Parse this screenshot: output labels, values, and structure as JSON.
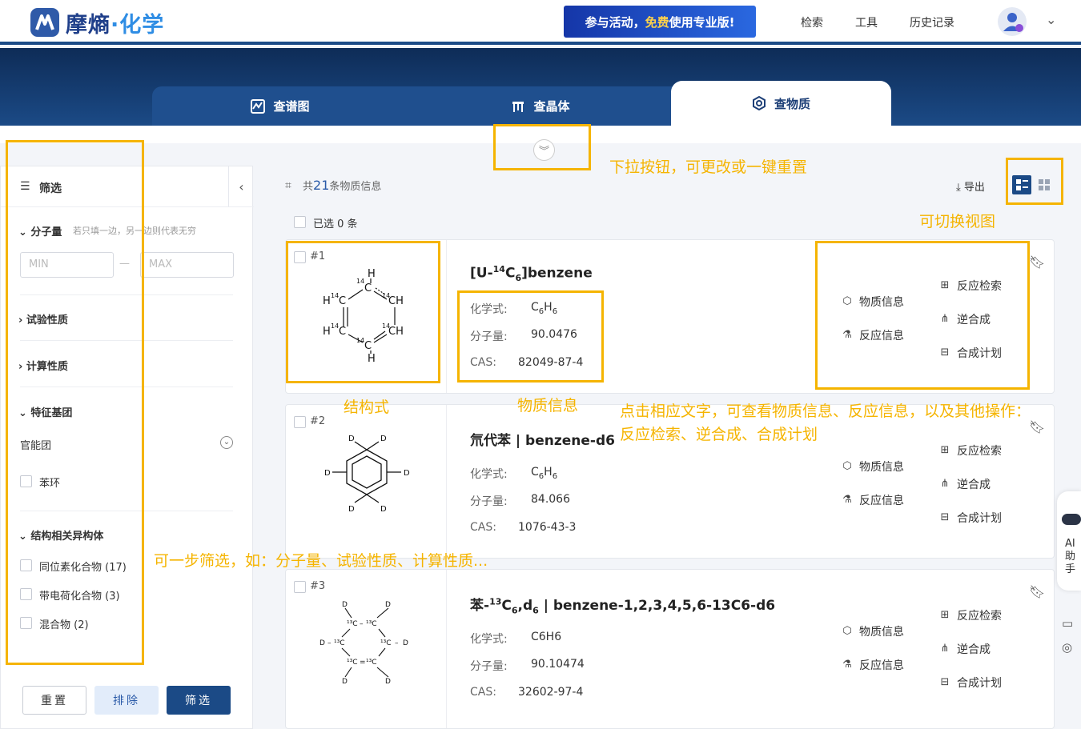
{
  "header": {
    "logo_main": "摩熵",
    "logo_sep": "·",
    "logo_sub": "化学",
    "promo_pre": "参与活动，",
    "promo_hl": "免费",
    "promo_post": "使用专业版!",
    "nav": [
      "检索",
      "工具",
      "历史记录"
    ]
  },
  "tabs": [
    {
      "label": "查谱图",
      "icon": "spectrum-icon"
    },
    {
      "label": "查晶体",
      "icon": "crystal-icon"
    },
    {
      "label": "查物质",
      "icon": "substance-icon",
      "active": true
    }
  ],
  "sidebar": {
    "title": "筛选",
    "mw_label": "分子量",
    "mw_hint": "若只填一边，另一边则代表无穷",
    "min_placeholder": "MIN",
    "max_placeholder": "MAX",
    "dash": "—",
    "exp_props": "试验性质",
    "calc_props": "计算性质",
    "feature_groups": "特征基团",
    "functional_group": "官能团",
    "benzene_ring": "苯环",
    "isomers": "结构相关异构体",
    "isomer_items": [
      "同位素化合物 (17)",
      "带电荷化合物 (3)",
      "混合物 (2)"
    ],
    "reset": "重置",
    "exclude": "排除",
    "filter": "筛选"
  },
  "results": {
    "count_prefix": "共",
    "count": "21",
    "count_suffix": "条物质信息",
    "export": "导出",
    "selected": "已选 0 条",
    "formula_label": "化学式:",
    "mw_label": "分子量:",
    "cas_label": "CAS:",
    "actions": {
      "info": "物质信息",
      "reaction_info": "反应信息",
      "reaction_search": "反应检索",
      "retro": "逆合成",
      "plan": "合成计划"
    },
    "items": [
      {
        "num": "#1",
        "title_a": "[U-",
        "title_sup": "14",
        "title_b": "C",
        "title_sub": "6",
        "title_c": "]benzene",
        "formula_a": "C",
        "formula_s1": "6",
        "formula_b": "H",
        "formula_s2": "6",
        "mw": "90.0476",
        "cas": "82049-87-4"
      },
      {
        "num": "#2",
        "title": "氘代苯 | benzene-d6",
        "formula_a": "C",
        "formula_s1": "6",
        "formula_b": "H",
        "formula_s2": "6",
        "mw": "84.066",
        "cas": "1076-43-3"
      },
      {
        "num": "#3",
        "title_a": "苯-",
        "title_sup": "13",
        "title_b": "C",
        "title_sub": "6",
        "title_c": ",d",
        "title_sub2": "6",
        "title_d": " | benzene-1,2,3,4,5,6-13C6-d6",
        "formula": "C6H6",
        "mw": "90.10474",
        "cas": "32602-97-4"
      }
    ]
  },
  "annotations": {
    "dropdown": "下拉按钮，可更改或一键重置",
    "view": "可切换视图",
    "structure": "结构式",
    "substance": "物质信息",
    "click1": "点击相应文字，可查看物质信息、反应信息，以及其他操作：",
    "click2": "反应检索、逆合成、合成计划",
    "filter": "可一步筛选，如：分子量、试验性质、计算性质..."
  },
  "ai": "AI助手",
  "colors": {
    "navy": "#1b4a86",
    "accent": "#f5b400",
    "filter_btn": "#1b4a86"
  }
}
